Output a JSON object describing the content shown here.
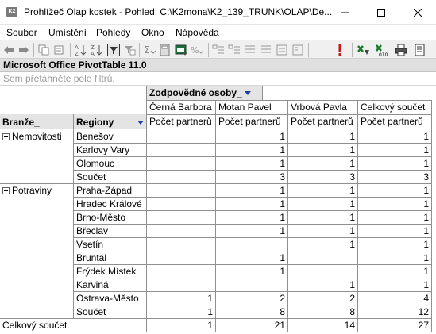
{
  "window": {
    "title": "Prohlížeč Olap kostek - Pohled: C:\\K2mona\\K2_139_TRUNK\\OLAP\\De..."
  },
  "menu": [
    "Soubor",
    "Umístění",
    "Pohledy",
    "Okno",
    "Nápověda"
  ],
  "pivot": {
    "header": "Microsoft Office PivotTable 11.0",
    "filter_hint": "Sem přetáhněte pole filtrů.",
    "column_field": "Zodpovědné osoby_",
    "row_fields": [
      "Branže_",
      "Regiony"
    ],
    "columns": [
      "Černá Barbora",
      "Motan Pavel",
      "Vrbová Pavla",
      "Celkový součet"
    ],
    "measure": "Počet partnerů",
    "groups": [
      {
        "name": "Nemovitosti",
        "rows": [
          {
            "region": "Benešov",
            "values": [
              "",
              "1",
              "1",
              "1"
            ]
          },
          {
            "region": "Karlovy Vary",
            "values": [
              "",
              "1",
              "1",
              "1"
            ]
          },
          {
            "region": "Olomouc",
            "values": [
              "",
              "1",
              "1",
              "1"
            ]
          },
          {
            "region": "Součet",
            "values": [
              "",
              "3",
              "3",
              "3"
            ]
          }
        ]
      },
      {
        "name": "Potraviny",
        "rows": [
          {
            "region": "Praha-Západ",
            "values": [
              "",
              "1",
              "1",
              "1"
            ]
          },
          {
            "region": "Hradec Králové",
            "values": [
              "",
              "1",
              "1",
              "1"
            ]
          },
          {
            "region": "Brno-Město",
            "values": [
              "",
              "1",
              "1",
              "1"
            ]
          },
          {
            "region": "Břeclav",
            "values": [
              "",
              "1",
              "1",
              "1"
            ]
          },
          {
            "region": "Vsetín",
            "values": [
              "",
              "",
              "1",
              "1"
            ]
          },
          {
            "region": "Bruntál",
            "values": [
              "",
              "1",
              "",
              "1"
            ]
          },
          {
            "region": "Frýdek Místek",
            "values": [
              "",
              "1",
              "",
              "1"
            ]
          },
          {
            "region": "Karviná",
            "values": [
              "",
              "",
              "1",
              "1"
            ]
          },
          {
            "region": "Ostrava-Město",
            "values": [
              "1",
              "2",
              "2",
              "4"
            ]
          },
          {
            "region": "Součet",
            "values": [
              "1",
              "8",
              "8",
              "12"
            ]
          }
        ]
      }
    ],
    "grand_total": {
      "label": "Celkový součet",
      "values": [
        "1",
        "21",
        "14",
        "27"
      ]
    }
  }
}
